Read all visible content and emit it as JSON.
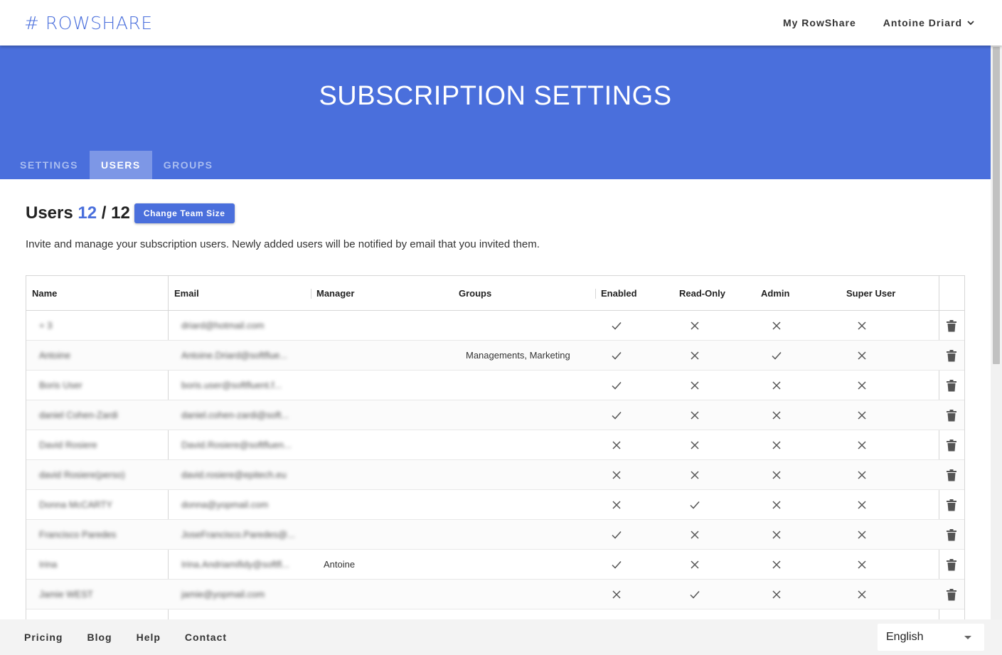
{
  "app": {
    "logo": "# ROWSHARE"
  },
  "topnav": {
    "my_rowshare": "My RowShare",
    "user_name": "Antoine Driard"
  },
  "hero": {
    "title": "SUBSCRIPTION SETTINGS"
  },
  "tabs": [
    {
      "label": "SETTINGS",
      "active": false
    },
    {
      "label": "USERS",
      "active": true
    },
    {
      "label": "GROUPS",
      "active": false
    }
  ],
  "users": {
    "title": "Users",
    "used": "12",
    "separator": " / ",
    "total": "12",
    "change_team_button": "Change Team Size",
    "description": "Invite and manage your subscription users. Newly added users will be notified by email that you invited them."
  },
  "table": {
    "columns": {
      "name": "Name",
      "email": "Email",
      "manager": "Manager",
      "groups": "Groups",
      "enabled": "Enabled",
      "read_only": "Read-Only",
      "admin": "Admin",
      "super_user": "Super User"
    },
    "rows": [
      {
        "name": "+ 3",
        "email": "driard@hotmail.com",
        "manager": "",
        "groups": "",
        "enabled": true,
        "read_only": false,
        "admin": false,
        "super_user": false
      },
      {
        "name": "Antoine",
        "email": "Antoine.Driard@softflue...",
        "manager": "",
        "groups": "Managements, Marketing",
        "enabled": true,
        "read_only": false,
        "admin": true,
        "super_user": false
      },
      {
        "name": "Boris User",
        "email": "boris.user@softfluent.f...",
        "manager": "",
        "groups": "",
        "enabled": true,
        "read_only": false,
        "admin": false,
        "super_user": false
      },
      {
        "name": "daniel Cohen-Zardi",
        "email": "daniel.cohen-zardi@soft...",
        "manager": "",
        "groups": "",
        "enabled": true,
        "read_only": false,
        "admin": false,
        "super_user": false
      },
      {
        "name": "David Rosiere",
        "email": "David.Rosiere@softfluen...",
        "manager": "",
        "groups": "",
        "enabled": false,
        "read_only": false,
        "admin": false,
        "super_user": false
      },
      {
        "name": "david Rosiere(perso)",
        "email": "david.rosiere@epitech.eu",
        "manager": "",
        "groups": "",
        "enabled": false,
        "read_only": false,
        "admin": false,
        "super_user": false
      },
      {
        "name": "Donna McCARTY",
        "email": "donna@yopmail.com",
        "manager": "",
        "groups": "",
        "enabled": false,
        "read_only": true,
        "admin": false,
        "super_user": false
      },
      {
        "name": "Francisco Paredes",
        "email": "JoseFrancisco.Paredes@...",
        "manager": "",
        "groups": "",
        "enabled": true,
        "read_only": false,
        "admin": false,
        "super_user": false
      },
      {
        "name": "Irina",
        "email": "Irina.Andriamifidy@softfl...",
        "manager": "Antoine",
        "groups": "",
        "enabled": true,
        "read_only": false,
        "admin": false,
        "super_user": false
      },
      {
        "name": "Jamie WEST",
        "email": "jamie@yopmail.com",
        "manager": "",
        "groups": "",
        "enabled": false,
        "read_only": true,
        "admin": false,
        "super_user": false
      }
    ]
  },
  "footer": {
    "links": [
      "Pricing",
      "Blog",
      "Help",
      "Contact"
    ],
    "language": "English"
  },
  "icons": {
    "check": "check-icon",
    "cross": "close-icon",
    "delete": "trash-icon",
    "chevron": "chevron-down-icon"
  },
  "colors": {
    "brand": "#4a6fdc",
    "tab_active": "#7d97e6"
  }
}
